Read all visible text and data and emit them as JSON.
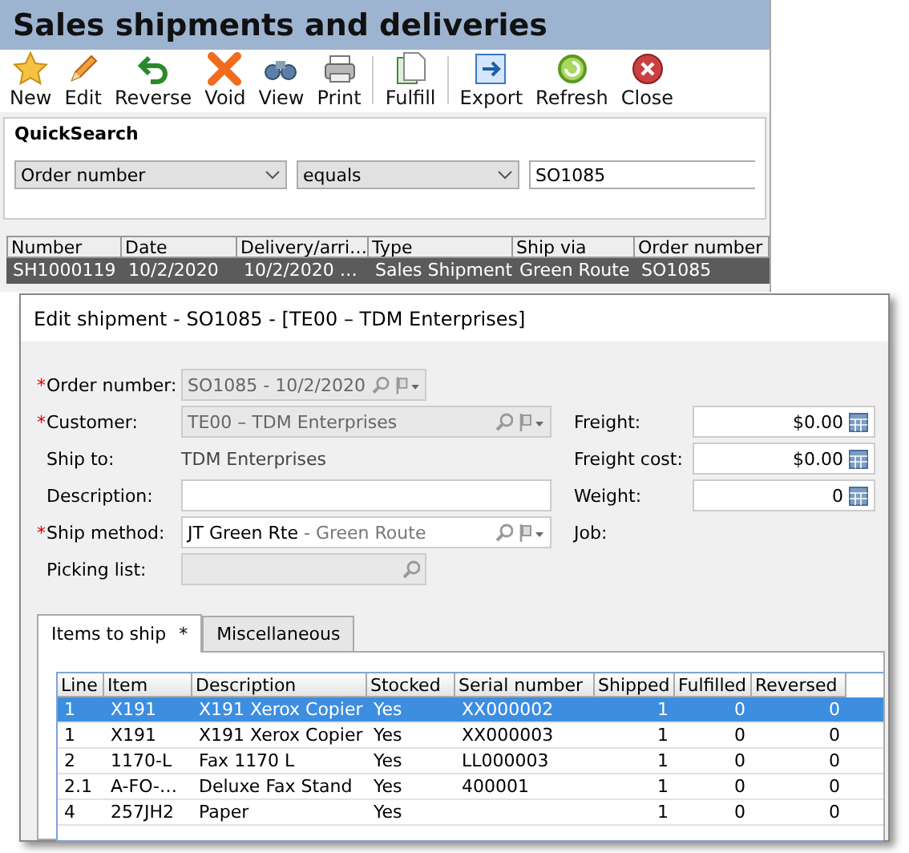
{
  "window": {
    "title": "Sales shipments and deliveries"
  },
  "toolbar": {
    "groups": [
      [
        {
          "label": "New",
          "kind": "star"
        },
        {
          "label": "Edit",
          "kind": "pencil"
        },
        {
          "label": "Reverse",
          "kind": "undo"
        },
        {
          "label": "Void",
          "kind": "cross"
        },
        {
          "label": "View",
          "kind": "binoculars"
        },
        {
          "label": "Print",
          "kind": "printer"
        }
      ],
      [
        {
          "label": "Fulfill",
          "kind": "document"
        }
      ],
      [
        {
          "label": "Export",
          "kind": "export"
        },
        {
          "label": "Refresh",
          "kind": "refresh"
        },
        {
          "label": "Close",
          "kind": "close"
        }
      ]
    ]
  },
  "quicksearch": {
    "title": "QuickSearch",
    "field": "Order number",
    "operator": "equals",
    "value": "SO1085"
  },
  "table": {
    "columns": [
      "Number",
      "Date",
      "Delivery/arri…",
      "Type",
      "Ship via",
      "Order number"
    ],
    "rows": [
      {
        "cells": [
          "SH1000119",
          "10/2/2020",
          "10/2/2020 …",
          "Sales Shipment",
          "Green Route",
          "SO1085"
        ],
        "selected": true
      }
    ]
  },
  "dialog": {
    "title": "Edit shipment - SO1085 - [TE00 – TDM Enterprises]",
    "fields_left": [
      {
        "label": "Order number:",
        "required": true,
        "kind": "lookup",
        "value": "SO1085 - 10/2/2020",
        "disabled": true
      },
      {
        "label": "Customer:",
        "required": true,
        "kind": "lookup",
        "value": "TE00 – TDM Enterprises",
        "disabled": true
      },
      {
        "label": "Ship to:",
        "required": false,
        "kind": "text",
        "value": "TDM Enterprises"
      },
      {
        "label": "Description:",
        "required": false,
        "kind": "input",
        "disabled": false
      },
      {
        "label": "Ship method:",
        "required": true,
        "kind": "lookup",
        "value": "JT Green Rte",
        "detail": "- Green Route",
        "disabled": false
      },
      {
        "label": "Picking list:",
        "required": false,
        "kind": "search",
        "disabled": true
      }
    ],
    "fields_right": [
      {
        "label": "Freight:",
        "kind": "number",
        "value": "$0.00"
      },
      {
        "label": "Freight cost:",
        "kind": "number",
        "value": "$0.00"
      },
      {
        "label": "Weight:",
        "kind": "number",
        "value": "0"
      },
      {
        "label": "Job:",
        "kind": "text"
      }
    ],
    "tabs": [
      {
        "label": "Items to ship",
        "marker": "*",
        "selected": true
      },
      {
        "label": "Miscellaneous",
        "selected": false
      }
    ],
    "items": {
      "columns": [
        "Line",
        "Item",
        "Description",
        "Stocked",
        "Serial number",
        "Shipped",
        "Fulfilled",
        "Reversed"
      ],
      "rows": [
        {
          "cells": [
            "1",
            "X191",
            "X191 Xerox Copier",
            "Yes",
            "XX000002",
            "1",
            "0",
            "0"
          ],
          "selected": true
        },
        {
          "cells": [
            "1",
            "X191",
            "X191 Xerox Copier",
            "Yes",
            "XX000003",
            "1",
            "0",
            "0"
          ],
          "selected": false
        },
        {
          "cells": [
            "2",
            "1170-L",
            "Fax 1170 L",
            "Yes",
            "LL000003",
            "1",
            "0",
            "0"
          ],
          "selected": false
        },
        {
          "cells": [
            "2.1",
            "A-FO-…",
            "Deluxe Fax Stand",
            "Yes",
            "400001",
            "1",
            "0",
            "0"
          ],
          "selected": false
        },
        {
          "cells": [
            "4",
            "257JH2",
            "Paper",
            "Yes",
            "",
            "1",
            "0",
            "0"
          ],
          "selected": false
        }
      ]
    }
  }
}
